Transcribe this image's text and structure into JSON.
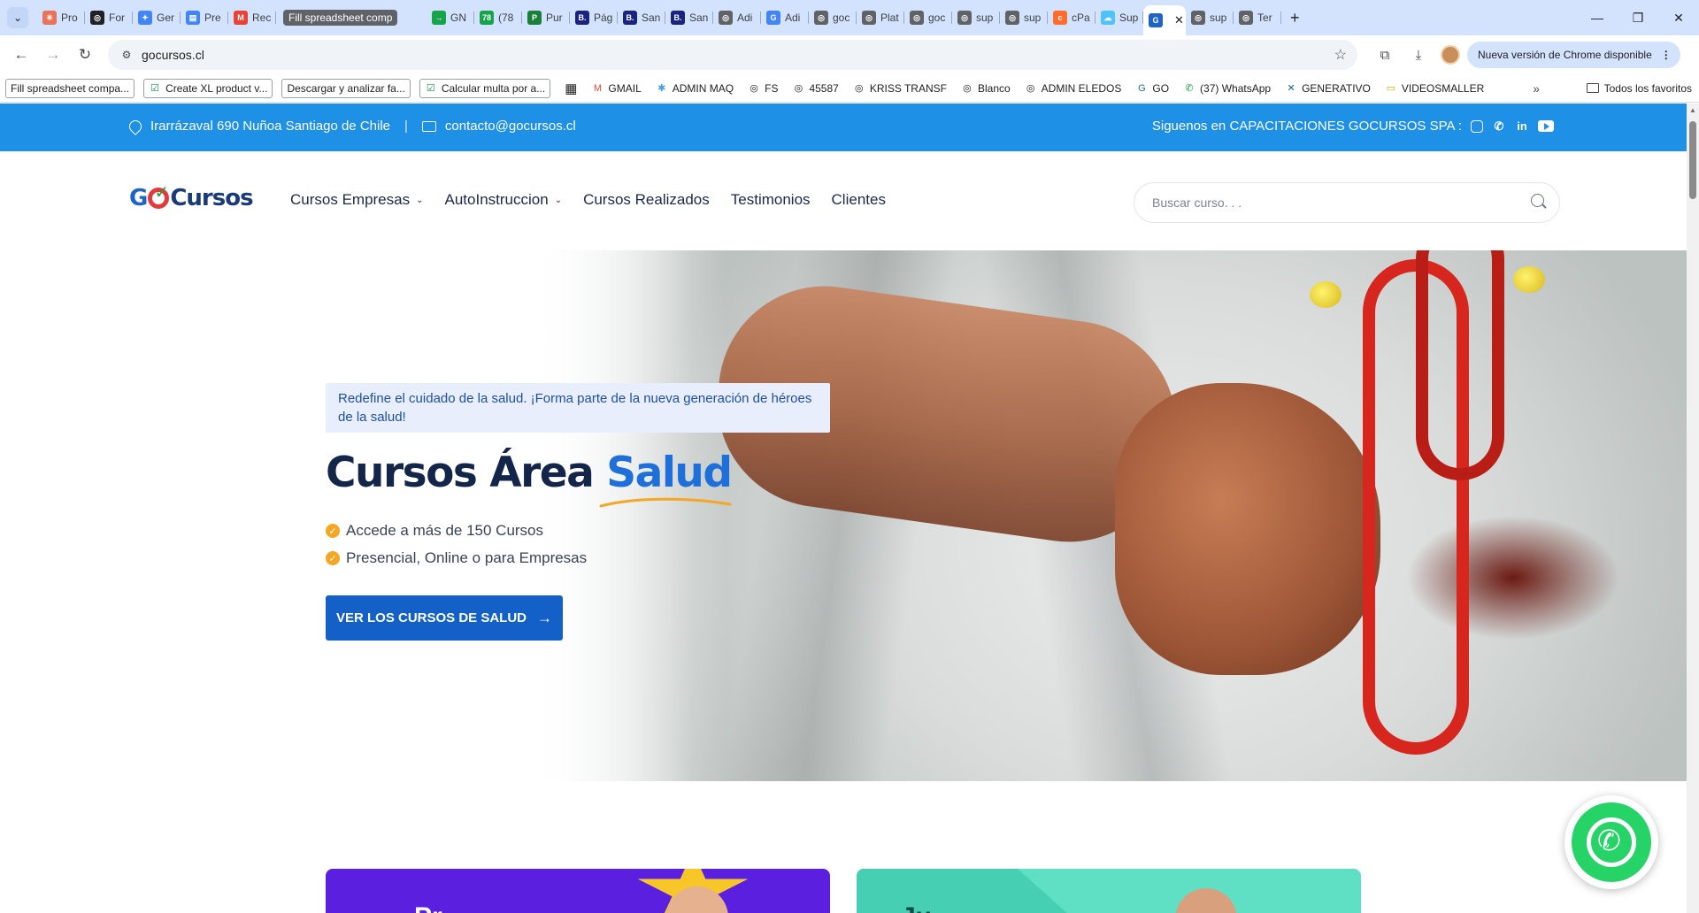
{
  "browser": {
    "tabs": [
      {
        "label": "Pro",
        "color": "#e8735a",
        "glyph": "✳"
      },
      {
        "label": "For",
        "color": "#202124",
        "glyph": "◎"
      },
      {
        "label": "Ger",
        "color": "#4285f4",
        "glyph": "✦"
      },
      {
        "label": "Pre",
        "color": "#4285f4",
        "glyph": "▤"
      },
      {
        "label": "Rec",
        "color": "#ea4335",
        "glyph": "M"
      },
      {
        "label": "Fill spreadsheet comp",
        "color": "#5f6368",
        "glyph": "",
        "dark": true
      },
      {
        "label": "GN",
        "color": "#16a34a",
        "glyph": "→"
      },
      {
        "label": "(78",
        "color": "#16a34a",
        "glyph": "78"
      },
      {
        "label": "Pur",
        "color": "#188038",
        "glyph": "P"
      },
      {
        "label": "Pág",
        "color": "#1a237e",
        "glyph": "B."
      },
      {
        "label": "San",
        "color": "#1a237e",
        "glyph": "B."
      },
      {
        "label": "San",
        "color": "#1a237e",
        "glyph": "B."
      },
      {
        "label": "Adi",
        "color": "#5f6368",
        "glyph": "◎"
      },
      {
        "label": "Adi",
        "color": "#4285f4",
        "glyph": "G"
      },
      {
        "label": "goc",
        "color": "#5f6368",
        "glyph": "◎"
      },
      {
        "label": "Plat",
        "color": "#5f6368",
        "glyph": "◎"
      },
      {
        "label": "goc",
        "color": "#5f6368",
        "glyph": "◎"
      },
      {
        "label": "sup",
        "color": "#5f6368",
        "glyph": "◎"
      },
      {
        "label": "sup",
        "color": "#5f6368",
        "glyph": "◎"
      },
      {
        "label": "cPa",
        "color": "#ff6c2c",
        "glyph": "c"
      },
      {
        "label": "Sup",
        "color": "#4fc3f7",
        "glyph": "☁"
      },
      {
        "label": "",
        "color": "#1e63c8",
        "glyph": "G",
        "active": true
      },
      {
        "label": "sup",
        "color": "#5f6368",
        "glyph": "◎"
      },
      {
        "label": "Ter",
        "color": "#5f6368",
        "glyph": "◎"
      }
    ],
    "url": "gocursos.cl",
    "update_label": "Nueva versión de Chrome disponible",
    "bookmarks_boxed": [
      {
        "label": "Fill spreadsheet compa...",
        "icon": ""
      },
      {
        "label": "Create XL product v...",
        "icon": "☑"
      },
      {
        "label": "Descargar y analizar fa...",
        "icon": ""
      },
      {
        "label": "Calcular multa por a...",
        "icon": "☑"
      }
    ],
    "bookmarks": [
      {
        "label": "GMAIL",
        "icon": "M",
        "color": "#ea4335"
      },
      {
        "label": "ADMIN MAQ",
        "icon": "✱",
        "color": "#3ea0e6"
      },
      {
        "label": "FS",
        "icon": "◎",
        "color": "#202124"
      },
      {
        "label": "45587",
        "icon": "◎",
        "color": "#202124"
      },
      {
        "label": "KRISS TRANSF",
        "icon": "◎",
        "color": "#202124"
      },
      {
        "label": "Blanco",
        "icon": "◎",
        "color": "#202124"
      },
      {
        "label": "ADMIN ELEDOS",
        "icon": "◎",
        "color": "#202124"
      },
      {
        "label": "GO",
        "icon": "G",
        "color": "#1e63c8"
      },
      {
        "label": "(37) WhatsApp",
        "icon": "✆",
        "color": "#16a34a"
      },
      {
        "label": "GENERATIVO",
        "icon": "✕",
        "color": "#0f5c8c"
      },
      {
        "label": "VIDEOSMALLER",
        "icon": "▭",
        "color": "#d9a400"
      }
    ],
    "all_bookmarks_label": "Todos los favoritos"
  },
  "site": {
    "topbar": {
      "address": "Irarrázaval 690 Nuñoa Santiago de Chile",
      "divider": "|",
      "email": "contacto@gocursos.cl",
      "social_label": "Siguenos en CAPACITACIONES GOCURSOS SPA :",
      "social_icons": [
        "instagram-icon",
        "whatsapp-icon",
        "linkedin-icon",
        "youtube-icon"
      ]
    },
    "logo": {
      "g": "G",
      "rest": "Cursos"
    },
    "menu": [
      {
        "label": "Cursos Empresas",
        "dropdown": true
      },
      {
        "label": "AutoInstruccion",
        "dropdown": true
      },
      {
        "label": "Cursos Realizados",
        "dropdown": false
      },
      {
        "label": "Testimonios",
        "dropdown": false
      },
      {
        "label": "Clientes",
        "dropdown": false
      }
    ],
    "search_placeholder": "Buscar curso. . .",
    "hero": {
      "tagline": "Redefine el cuidado de la salud. ¡Forma parte de la nueva generación de héroes de la salud!",
      "headline_main": "Cursos Área ",
      "headline_accent": "Salud",
      "bullets": [
        "Accede a más de 150 Cursos",
        "Presencial, Online o para Empresas"
      ],
      "cta_label": "VER LOS CURSOS DE SALUD",
      "accent_color": "#1e6fd9",
      "button_color": "#1460c9"
    },
    "cards": [
      {
        "title": "Pr",
        "color": "#5b1fe0"
      },
      {
        "title": "Ju",
        "color": "#5fe0c4"
      }
    ],
    "colors": {
      "topbar": "#1e90e6",
      "whatsapp": "#25d366",
      "check": "#f5a623"
    }
  }
}
